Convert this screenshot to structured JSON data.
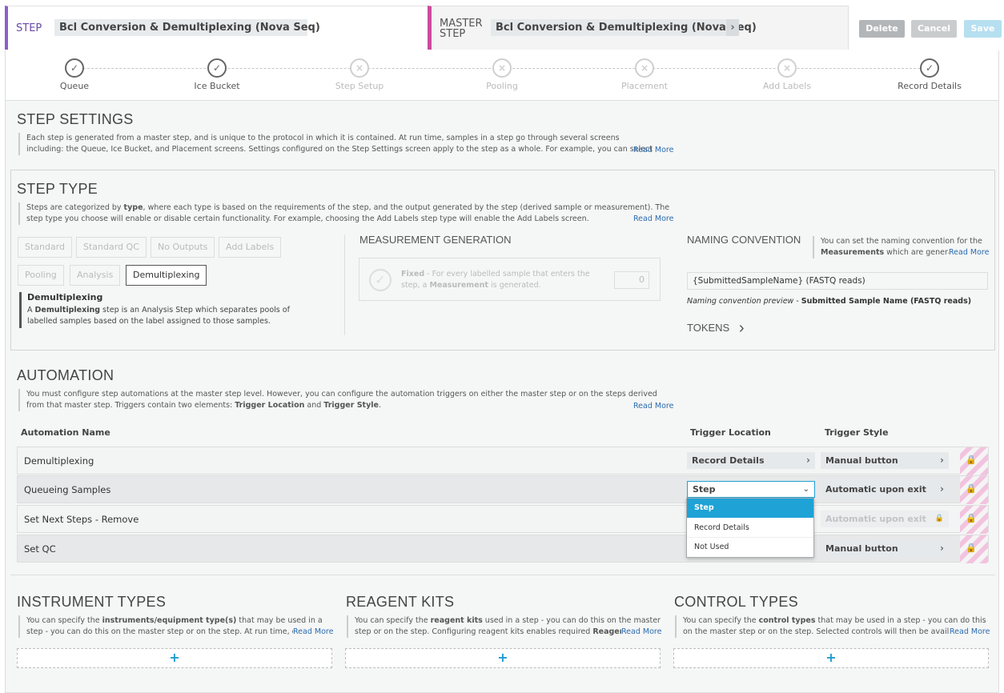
{
  "header": {
    "step_label": "STEP",
    "step_name": "Bcl Conversion & Demultiplexing (Nova Seq)",
    "master_label_1": "MASTER",
    "master_label_2": "STEP",
    "master_name": "Bcl Conversion & Demultiplexing (Nova Seq)",
    "delete": "Delete",
    "cancel": "Cancel",
    "save": "Save"
  },
  "progress": {
    "steps": [
      {
        "label": "Queue",
        "state": "done"
      },
      {
        "label": "Ice Bucket",
        "state": "done"
      },
      {
        "label": "Step Setup",
        "state": "off"
      },
      {
        "label": "Pooling",
        "state": "off"
      },
      {
        "label": "Placement",
        "state": "off"
      },
      {
        "label": "Add Labels",
        "state": "off"
      },
      {
        "label": "Record Details",
        "state": "done"
      }
    ]
  },
  "step_settings": {
    "title": "STEP SETTINGS",
    "desc": "Each step is generated from a master step, and is unique to the protocol in which it is contained. At run time, samples in a step go through several screens including: the Queue, Ice Bucket, and Placement screens. Settings configured on the Step Settings screen apply to the step as a whole. For example, you can select the reagent kits that will",
    "read_more": "Read More"
  },
  "step_type": {
    "title": "STEP TYPE",
    "desc_pre": "Steps are categorized by ",
    "desc_bold": "type",
    "desc_post": ", where each type is based on the requirements of the step, and the output generated by the step (derived sample or measurement). The step type you choose will enable or disable certain functionality. For example, choosing the Add Labels step type will enable the Add Labels screen.",
    "read_more": "Read More",
    "types": [
      "Standard",
      "Standard QC",
      "No Outputs",
      "Add Labels",
      "Pooling",
      "Analysis",
      "Demultiplexing"
    ],
    "selected": "Demultiplexing",
    "selected_title": "Demultiplexing",
    "selected_desc_1": "A ",
    "selected_desc_bold": "Demultiplexing",
    "selected_desc_2": " step is an Analysis Step which separates pools of labelled samples based on the label assigned to those samples."
  },
  "measurement": {
    "title": "MEASUREMENT GENERATION",
    "fixed": "Fixed",
    "text_1": " - For every labelled sample that enters the step, a ",
    "text_bold": "Measurement",
    "text_2": " is generated.",
    "value": "0"
  },
  "naming": {
    "title": "NAMING CONVENTION",
    "desc_1": "You can set the naming convention for the ",
    "desc_bold": "Measurements",
    "desc_2": " which are generated",
    "read_more": "Read More",
    "value": "{SubmittedSampleName} (FASTQ reads)",
    "preview_label": "Naming convention preview",
    "preview_value": "Submitted Sample Name (FASTQ reads)",
    "tokens": "TOKENS"
  },
  "automation": {
    "title": "AUTOMATION",
    "desc_1": "You must configure step automations at the master step level. However, you can configure the automation triggers on either the master step or on the steps derived from that master step. Triggers contain two elements: ",
    "desc_b1": "Trigger Location",
    "desc_and": " and ",
    "desc_b2": "Trigger Style",
    "desc_end": ".",
    "read_more": "Read More",
    "col_name": "Automation Name",
    "col_location": "Trigger Location",
    "col_style": "Trigger Style",
    "rows": [
      {
        "name": "Demultiplexing",
        "location": "Record Details",
        "style": "Manual button"
      },
      {
        "name": "Queueing Samples",
        "location": "Step",
        "style": "Automatic upon exit"
      },
      {
        "name": "Set Next Steps - Remove",
        "location": "",
        "style": "Automatic upon exit"
      },
      {
        "name": "Set QC",
        "location": "",
        "style": "Manual button"
      }
    ],
    "dropdown_options": [
      "Step",
      "Record Details",
      "Not Used"
    ],
    "dropdown_selected": "Step"
  },
  "instrument": {
    "title": "INSTRUMENT TYPES",
    "desc_1": "You can specify the ",
    "desc_bold": "instruments/equipment type(s)",
    "desc_2": " that may be used in a step - you can do this on the master step or on the step. At run time, on the Record",
    "read_more": "Read More",
    "add": "+"
  },
  "reagent": {
    "title": "REAGENT KITS",
    "desc_1": "You can specify the ",
    "desc_bold": "reagent kits",
    "desc_2": " used in a step - you can do this on the master step or on the step. Configuring reagent kits enables required ",
    "desc_bold2": "Reagent Lot Tr",
    "read_more": "Read More",
    "add": "+"
  },
  "control": {
    "title": "CONTROL TYPES",
    "desc_1": "You can specify the ",
    "desc_bold": "control types",
    "desc_2": " that may be used in a step - you can do this on the master step or on the step. Selected controls will then be available for th",
    "read_more": "Read More",
    "add": "+"
  },
  "colors": {
    "accent": "#1fa2d6",
    "step_border": "#8d5fc9",
    "master_border": "#cb4a9d",
    "lock": "#c2338b"
  }
}
